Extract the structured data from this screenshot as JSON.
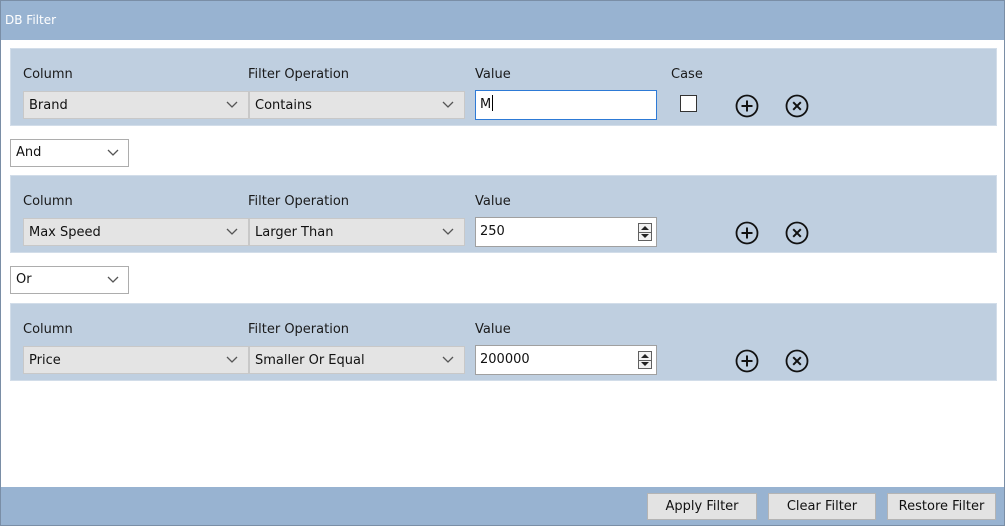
{
  "window": {
    "title": "DB Filter"
  },
  "labels": {
    "column": "Column",
    "filter_operation": "Filter Operation",
    "value": "Value",
    "case": "Case"
  },
  "rows": [
    {
      "column": "Brand",
      "operation": "Contains",
      "value": "M",
      "case_checked": false
    },
    {
      "column": "Max Speed",
      "operation": "Larger Than",
      "value": "250"
    },
    {
      "column": "Price",
      "operation": "Smaller Or Equal",
      "value": "200000"
    }
  ],
  "connectors": [
    "And",
    "Or"
  ],
  "icons": {
    "add": "add-circle-icon",
    "remove": "remove-circle-icon",
    "dropdown": "chevron-down-icon",
    "spinner": "spinner-arrows-icon"
  },
  "footer": {
    "apply": "Apply Filter",
    "clear": "Clear Filter",
    "restore": "Restore Filter"
  },
  "colors": {
    "titlebar": "#98b3d1",
    "row_bg": "#bfcfe0",
    "focus_border": "#2d7ad6"
  }
}
